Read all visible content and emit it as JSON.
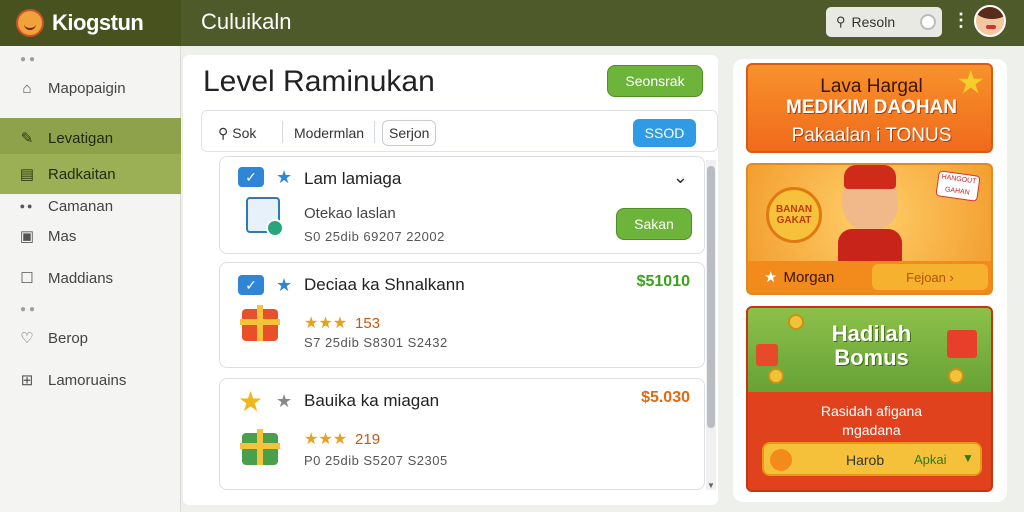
{
  "header": {
    "logo_text": "Kiogstun",
    "app_title": "Culuikaln",
    "user_label": "Resoln"
  },
  "sidebar": {
    "items": [
      {
        "label": "Mapopaigin",
        "icon": "home-icon"
      },
      {
        "label": "Levatigan",
        "icon": "edit-icon"
      },
      {
        "label": "Radkaitan",
        "icon": "grid-icon"
      },
      {
        "label": "Camanan",
        "icon": "dots-icon"
      },
      {
        "label": "Mas",
        "icon": "bag-icon"
      },
      {
        "label": "Maddians",
        "icon": "square-icon"
      },
      {
        "label": "Berop",
        "icon": "heart-icon"
      },
      {
        "label": "Lamoruains",
        "icon": "gift-icon"
      }
    ]
  },
  "main": {
    "title": "Level Raminukan",
    "top_button": "Seonsrak",
    "filters": {
      "search_label": "Sok",
      "tab1": "Modermlan",
      "tab2": "Serjon",
      "go_button": "SSOD"
    },
    "cards": [
      {
        "title": "Lam lamiaga",
        "subtitle": "Otekao laslan",
        "meta": "S0 25dib 69207 22002",
        "action": "Sakan"
      },
      {
        "title": "Deciaa ka Shnalkann",
        "price": "$51010",
        "price_color": "#3aa21a",
        "rating": "153",
        "meta": "S7 25dib S8301 S2432"
      },
      {
        "title": "Bauika ka miagan",
        "price": "$5.030",
        "price_color": "#e06a10",
        "rating": "219",
        "meta": "P0 25dib S5207 S2305"
      }
    ]
  },
  "promos": {
    "p1": {
      "line1": "Lava Hargal",
      "line2": "MEDIKIM DAOHAN",
      "line3": "Pakaalan i TONUS"
    },
    "p2": {
      "badge": "BANAN GAKAT",
      "tag": "HANGOUT GAHAN",
      "bar_label": "Morgan",
      "bar_button": "Fejoan ›"
    },
    "p3": {
      "title1": "Hadilah",
      "title2": "Bomus",
      "text1": "Rasidah afigana",
      "text2": "mgadana",
      "bar_label": "Harob",
      "bar_cta": "Apkai"
    }
  },
  "colors": {
    "topbar": "#4f5a2a",
    "sidebar_active": "#8da24a",
    "green_button": "#6cb43a",
    "blue_button": "#2f9ae6"
  }
}
